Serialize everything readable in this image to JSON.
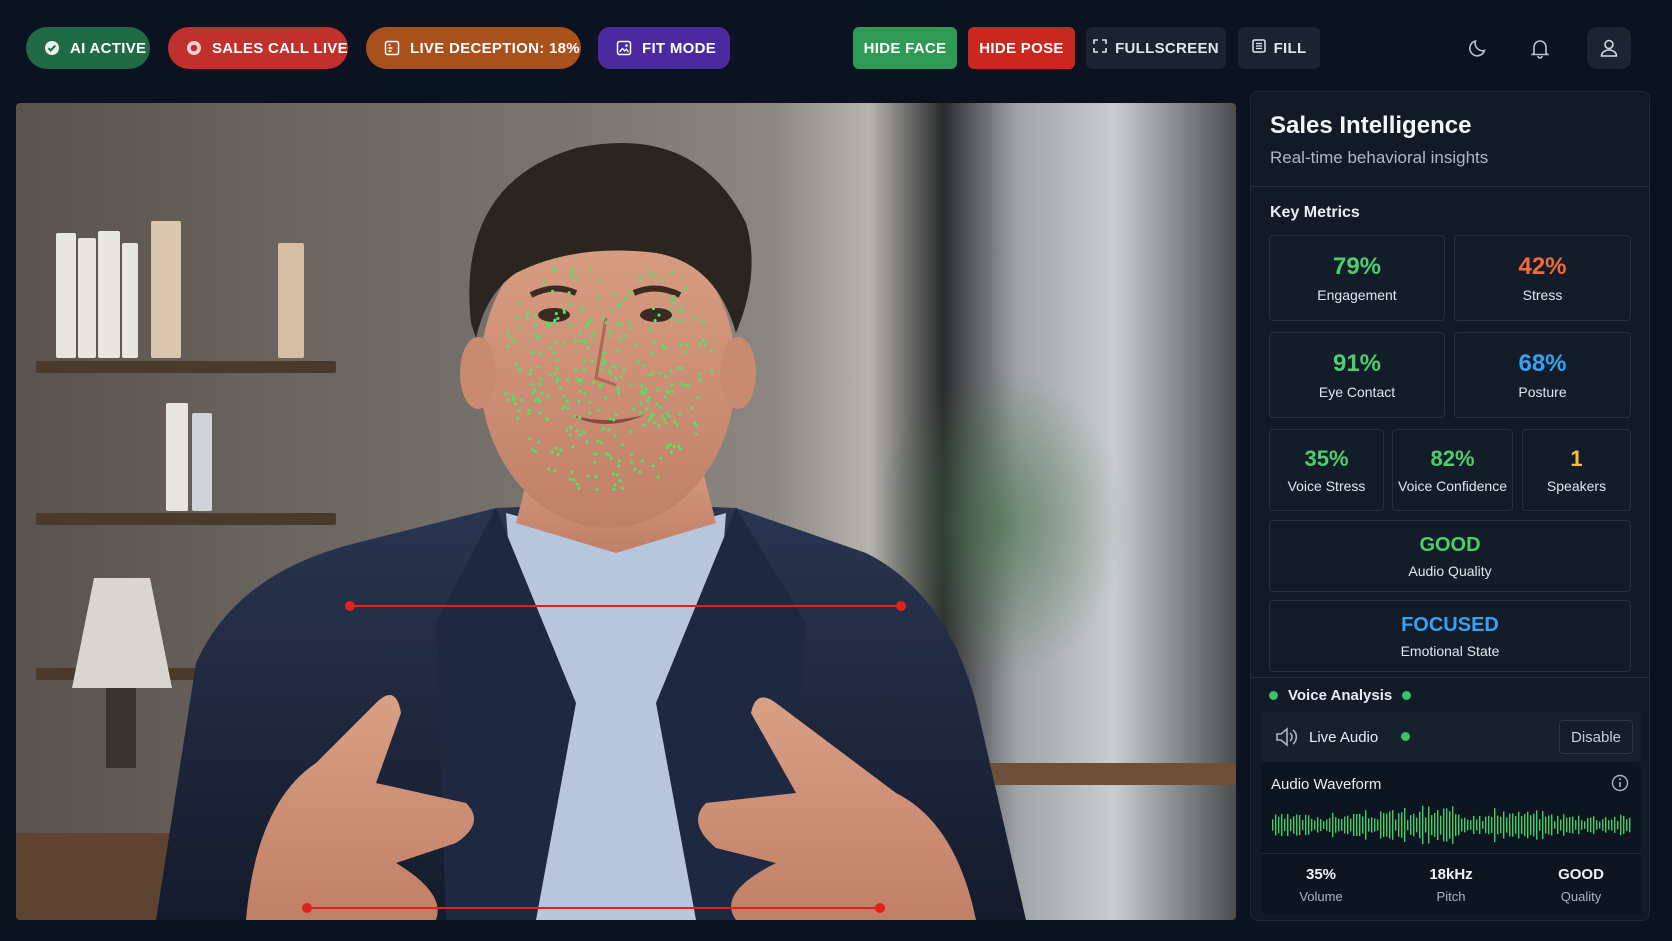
{
  "topbar": {
    "ai_active": "AI ACTIVE",
    "sales_call": "SALES CALL LIVE",
    "deception": "LIVE DECEPTION: 18%",
    "fit_mode": "FIT MODE",
    "hide_face": "HIDE FACE",
    "hide_pose": "HIDE POSE",
    "fullscreen": "FULLSCREEN",
    "fill": "FILL",
    "icons": [
      "moon-icon",
      "bell-icon",
      "user-icon"
    ]
  },
  "panel": {
    "title": "Sales Intelligence",
    "subtitle": "Real-time behavioral insights",
    "key_metrics_title": "Key Metrics",
    "engagement": {
      "value": "79%",
      "label": "Engagement"
    },
    "stress": {
      "value": "42%",
      "label": "Stress"
    },
    "eye_contact": {
      "value": "91%",
      "label": "Eye Contact"
    },
    "posture": {
      "value": "68%",
      "label": "Posture"
    },
    "voice_stress": {
      "value": "35%",
      "label": "Voice Stress"
    },
    "voice_confidence": {
      "value": "82%",
      "label": "Voice Confidence"
    },
    "speakers": {
      "value": "1",
      "label": "Speakers"
    },
    "audio_quality": {
      "value": "GOOD",
      "label": "Audio Quality"
    },
    "emotional_state": {
      "value": "FOCUSED",
      "label": "Emotional State"
    },
    "voice_analysis_title": "Voice Analysis",
    "live_audio_label": "Live Audio",
    "disable_label": "Disable",
    "waveform_title": "Audio Waveform",
    "stats": {
      "volume": {
        "value": "35%",
        "label": "Volume"
      },
      "pitch": {
        "value": "18kHz",
        "label": "Pitch"
      },
      "quality": {
        "value": "GOOD",
        "label": "Quality"
      }
    }
  },
  "colors": {
    "accent_green": "#4ccf6b",
    "accent_orange": "#f26b3a",
    "accent_blue": "#3aa0f0",
    "accent_yellow": "#f0c23a",
    "danger_red": "#c9271f"
  }
}
